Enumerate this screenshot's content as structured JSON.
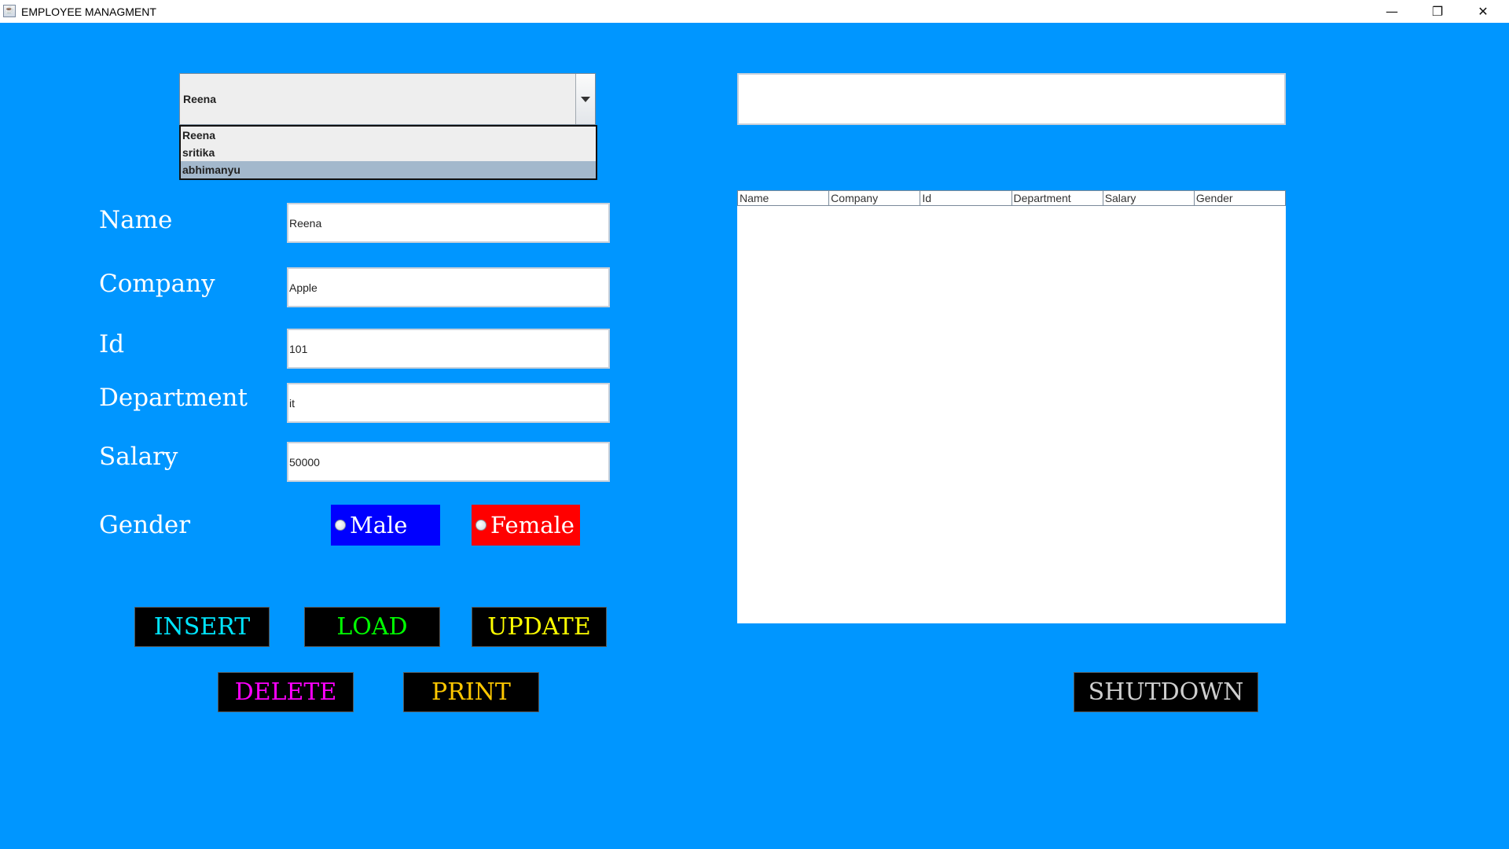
{
  "window": {
    "title": "EMPLOYEE MANAGMENT",
    "minimize_glyph": "—",
    "restore_glyph": "❐",
    "close_glyph": "✕"
  },
  "combo": {
    "selected": "Reena",
    "options": [
      "Reena",
      "sritika",
      "abhimanyu"
    ],
    "highlighted": "abhimanyu"
  },
  "form": {
    "name_label": "Name",
    "name_value": "Reena",
    "company_label": "Company",
    "company_value": "Apple",
    "id_label": "Id",
    "id_value": "101",
    "department_label": "Department",
    "department_value": "it",
    "salary_label": "Salary",
    "salary_value": "50000",
    "gender_label": "Gender",
    "male_label": "Male",
    "female_label": "Female"
  },
  "buttons": {
    "insert": "INSERT",
    "load": "LOAD",
    "update": "UPDATE",
    "delete": "DELETE",
    "print": "PRINT",
    "shutdown": "SHUTDOWN"
  },
  "table": {
    "columns": [
      "Name",
      "Company",
      "Id",
      "Department",
      "Salary",
      "Gender"
    ],
    "rows": []
  },
  "colors": {
    "background": "#0096ff",
    "male_bg": "#0000ff",
    "female_bg": "#ff0000",
    "insert_text": "#00e5ff",
    "load_text": "#00ff00",
    "update_text": "#ffff00",
    "delete_text": "#ff00ff",
    "print_text": "#ffc800",
    "shutdown_text": "#cfcfcf"
  }
}
